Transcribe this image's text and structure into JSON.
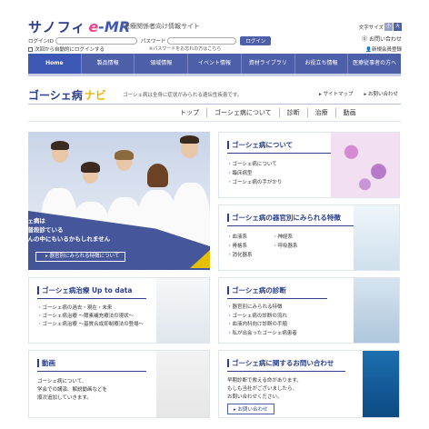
{
  "header": {
    "logo_jp": "サノフィ",
    "logo_emr_e": "e",
    "logo_emr_rest": "-MR",
    "tagline": "医療関係者向け情報サイト",
    "login_label": "ログインID",
    "password_label": "パスワード",
    "login_button": "ログイン",
    "auto_login": "次回から自動的にログインする",
    "forgot": "※パスワードをお忘れの方はこちら",
    "fontsize_label": "文字サイズ",
    "fontsize_small": "小",
    "fontsize_large": "大",
    "contact": "お問い合わせ",
    "register": "新規会員登録"
  },
  "nav": {
    "items": [
      "Home",
      "製品情報",
      "領域情報",
      "イベント情報",
      "資材ライブラリ",
      "お役立ち情報",
      "医療従事者の方へ"
    ]
  },
  "section": {
    "title_part1": "ゴーシェ病",
    "title_part2": "ナビ",
    "description": "ゴーシェ病は全身に症状がみられる遺伝性疾患です。",
    "sitemap": "サイトマップ",
    "contact": "お問い合わせ"
  },
  "subnav": {
    "items": [
      "トップ",
      "ゴーシェ病について",
      "診断",
      "治療",
      "動画"
    ]
  },
  "hero": {
    "line1": "ゴーシェ病は",
    "line2": "先生の普段診ている",
    "line3": "患者さんの中にもいるかもしれません",
    "button": "器官別にみられる特徴について"
  },
  "cards": {
    "about": {
      "title": "ゴーシェ病について",
      "items": [
        "ゴーシェ病について",
        "臨床病型",
        "ゴーシェ病の手がかり"
      ]
    },
    "organs": {
      "title": "ゴーシェ病の器官別にみられる特徴",
      "col1": [
        "血液系",
        "骨格系",
        "消化器系"
      ],
      "col2": [
        "神経系",
        "呼吸器系"
      ]
    },
    "treatment": {
      "title": "ゴーシェ病治療 Up to data",
      "items": [
        "ゴーシェ病の過去・現在・未来",
        "ゴーシェ病治療 ～酵素補充療法の現状～",
        "ゴーシェ病治療 ～基質合成抑制療法の登場～"
      ]
    },
    "diagnosis": {
      "title": "ゴーシェ病の診断",
      "items": [
        "器官別にみられる特徴",
        "ゴーシェ病の診断の流れ",
        "血液内科向け診断の手順",
        "私が出会ったゴーシェ病患者"
      ]
    },
    "video": {
      "title": "動画",
      "line1": "ゴーシェ病について、",
      "line2": "学会での講演、解説動画などを",
      "line3": "順次追加していきます。"
    },
    "inquiry": {
      "title": "ゴーシェ病に関するお問い合わせ",
      "line1": "早期診断で救える命があります。",
      "line2": "もしも当社がございましたら、",
      "line3": "お問い合わせください。",
      "button": "お問い合わせ"
    }
  }
}
